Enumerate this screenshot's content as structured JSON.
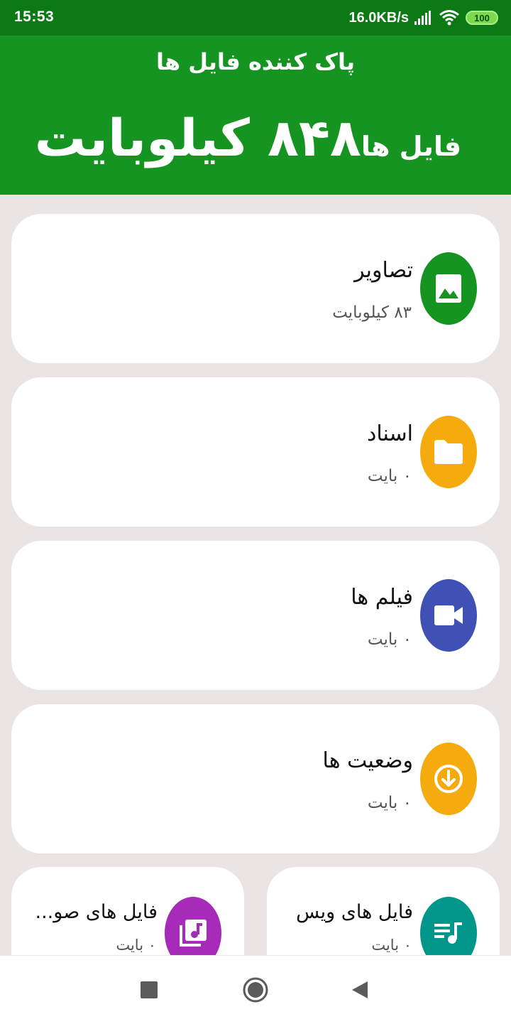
{
  "status_bar": {
    "time": "15:53",
    "network_speed": "16.0KB/s",
    "battery": "100"
  },
  "header": {
    "title": "پاک کننده فایل ها",
    "size_label": "فایل ها",
    "size_value": "۸۴۸ کیلوبایت"
  },
  "categories": [
    {
      "title": "تصاویر",
      "size": "۸۳ کیلوبایت",
      "icon": "image-icon",
      "color": "#169421"
    },
    {
      "title": "اسناد",
      "size": "۰ بایت",
      "icon": "folder-icon",
      "color": "#f5ab0e"
    },
    {
      "title": "فیلم ها",
      "size": "۰ بایت",
      "icon": "video-camera-icon",
      "color": "#3f51b5"
    },
    {
      "title": "وضعیت ها",
      "size": "۰ بایت",
      "icon": "download-icon",
      "color": "#f5ab0e"
    },
    {
      "title": "فایل های ویس",
      "size": "۰ بایت",
      "icon": "voice-playlist-icon",
      "color": "#00968a"
    },
    {
      "title": "فایل های صو...",
      "size": "۰ بایت",
      "icon": "audio-library-icon",
      "color": "#a62bb8"
    }
  ],
  "navigation": {
    "buttons": [
      "recents-icon",
      "home-icon",
      "back-icon"
    ]
  }
}
